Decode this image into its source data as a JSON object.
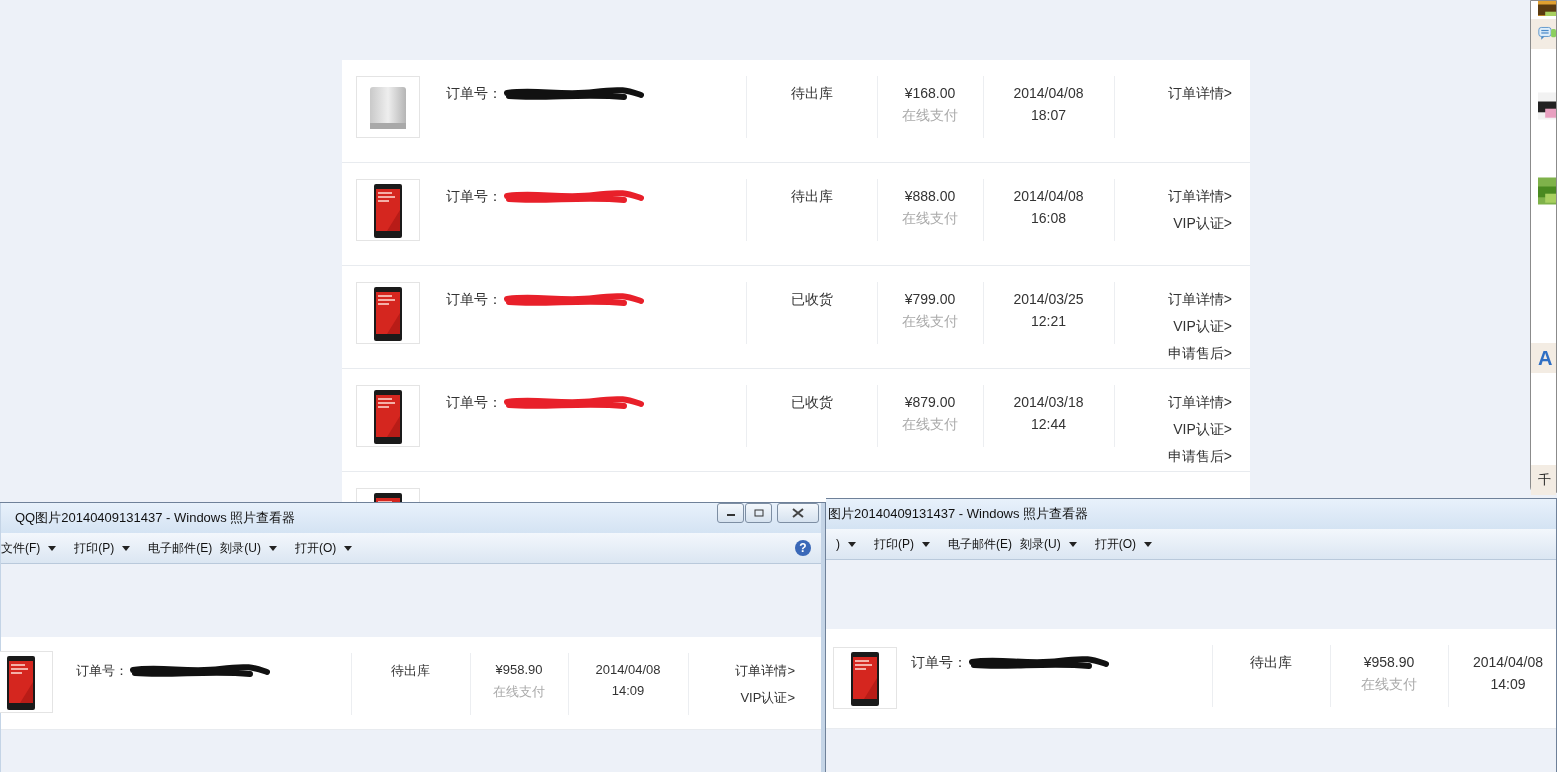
{
  "order_list": {
    "rows": [
      {
        "kind": "powerbank",
        "order_label": "订单号：",
        "color": "#111111",
        "status": "待出库",
        "price": "¥168.00",
        "payment": "在线支付",
        "date": "2014/04/08",
        "time": "18:07",
        "links": [
          "订单详情>"
        ]
      },
      {
        "kind": "phone",
        "order_label": "订单号：",
        "color": "#e8202a",
        "status": "待出库",
        "price": "¥888.00",
        "payment": "在线支付",
        "date": "2014/04/08",
        "time": "16:08",
        "links": [
          "订单详情>",
          "VIP认证>"
        ]
      },
      {
        "kind": "phone",
        "order_label": "订单号：",
        "color": "#e8202a",
        "status": "已收货",
        "price": "¥799.00",
        "payment": "在线支付",
        "date": "2014/03/25",
        "time": "12:21",
        "links": [
          "订单详情>",
          "VIP认证>",
          "申请售后>"
        ]
      },
      {
        "kind": "phone",
        "order_label": "订单号：",
        "color": "#e8202a",
        "status": "已收货",
        "price": "¥879.00",
        "payment": "在线支付",
        "date": "2014/03/18",
        "time": "12:44",
        "links": [
          "订单详情>",
          "VIP认证>",
          "申请售后>"
        ]
      },
      {
        "kind": "phone"
      }
    ]
  },
  "side_panel": {
    "items": [
      {
        "kind": "picture"
      },
      {
        "kind": "chat"
      },
      {
        "kind": "picture"
      },
      {
        "kind": "picture"
      },
      {
        "kind": "letter",
        "text": "A"
      },
      {
        "kind": "text",
        "text": "千"
      }
    ]
  },
  "windows": [
    {
      "title": "QQ图片20140409131437 - Windows 照片查看器",
      "caption_buttons": true,
      "help": "?",
      "menu": [
        {
          "label": "文件(F)",
          "dropdown": true
        },
        {
          "label": "打印(P)",
          "dropdown": true
        },
        {
          "label": "电子邮件(E)",
          "dropdown": false
        },
        {
          "label": "刻录(U)",
          "dropdown": true
        },
        {
          "label": "打开(O)",
          "dropdown": true
        }
      ],
      "order_row": {
        "kind": "phone",
        "order_label": "订单号：",
        "color": "#111111",
        "status": "待出库",
        "price": "¥958.90",
        "payment": "在线支付",
        "date": "2014/04/08",
        "time": "14:09",
        "links": [
          "订单详情>",
          "VIP认证>"
        ]
      }
    },
    {
      "title": "图片20140409131437 - Windows 照片查看器",
      "caption_buttons": false,
      "menu": [
        {
          "label": ")",
          "dropdown": true
        },
        {
          "label": "打印(P)",
          "dropdown": true
        },
        {
          "label": "电子邮件(E)",
          "dropdown": false
        },
        {
          "label": "刻录(U)",
          "dropdown": true
        },
        {
          "label": "打开(O)",
          "dropdown": true
        }
      ],
      "order_row": {
        "kind": "phone",
        "order_label": "订单号：",
        "color": "#111111",
        "status": "待出库",
        "price": "¥958.90",
        "payment": "在线支付",
        "date": "2014/04/08",
        "time": "14:09"
      }
    }
  ]
}
